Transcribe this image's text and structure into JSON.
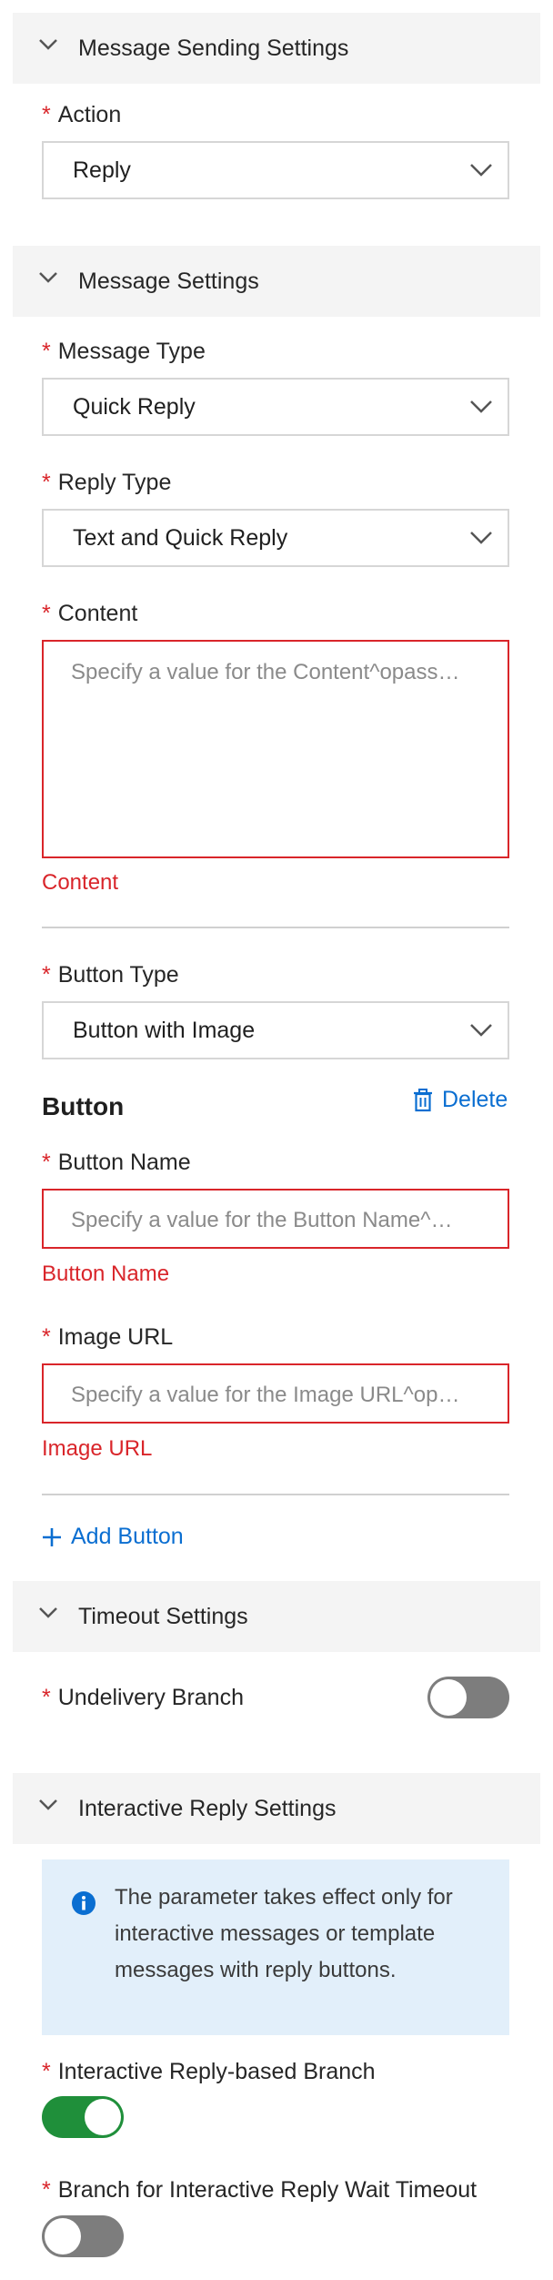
{
  "sections": {
    "sending": {
      "title": "Message Sending Settings"
    },
    "message": {
      "title": "Message Settings"
    },
    "timeout": {
      "title": "Timeout Settings"
    },
    "interactive": {
      "title": "Interactive Reply Settings"
    }
  },
  "fields": {
    "action": {
      "label": "Action",
      "value": "Reply"
    },
    "message_type": {
      "label": "Message Type",
      "value": "Quick Reply"
    },
    "reply_type": {
      "label": "Reply Type",
      "value": "Text and Quick Reply"
    },
    "content": {
      "label": "Content",
      "placeholder": "Specify a value for the Content^opass…",
      "error": "Content"
    },
    "button_type": {
      "label": "Button Type",
      "value": "Button with Image"
    },
    "button_name": {
      "label": "Button Name",
      "placeholder": "Specify a value for the Button Name^…",
      "error": "Button Name"
    },
    "image_url": {
      "label": "Image URL",
      "placeholder": "Specify a value for the Image URL^op…",
      "error": "Image URL"
    },
    "undelivery_branch": {
      "label": "Undelivery Branch",
      "on": false
    },
    "interactive_branch": {
      "label": "Interactive Reply-based Branch",
      "on": true
    },
    "wait_timeout_branch": {
      "label": "Branch for Interactive Reply Wait Timeout",
      "on": false
    }
  },
  "button_group": {
    "title": "Button",
    "delete_label": "Delete",
    "add_label": "Add Button"
  },
  "info": {
    "text": "The parameter takes effect only for interactive messages or template messages with reply buttons."
  },
  "required_mark": "*",
  "colors": {
    "error": "#d9252a",
    "link": "#0a6ed1",
    "toggle_on": "#1f8f3a",
    "toggle_off": "#7d7d7d",
    "info_bg": "#e2effa"
  }
}
